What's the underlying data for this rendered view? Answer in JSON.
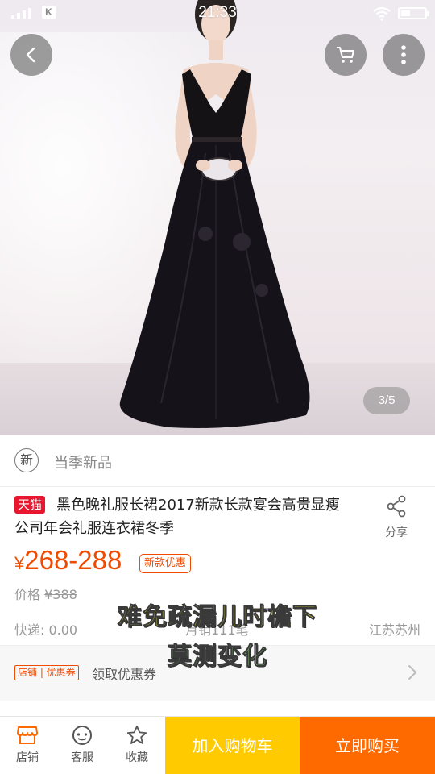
{
  "status_bar": {
    "time": "21:33",
    "app_badge": "K",
    "battery_level": 0.35
  },
  "gallery": {
    "counter": "3/5"
  },
  "season": {
    "icon_text": "新",
    "label": "当季新品"
  },
  "product": {
    "store_tag": "天猫",
    "title": "黑色晚礼服长裙2017新款长款宴会高贵显瘦公司年会礼服连衣裙冬季",
    "share_label": "分享",
    "price_symbol": "¥",
    "price_range": "268-288",
    "promo_tag": "新款优惠",
    "orig_price_label": "价格",
    "orig_price_value": "¥388",
    "express": "快递: 0.00",
    "monthly_sales": "月销111笔",
    "location": "江苏苏州"
  },
  "coupon": {
    "tag": "店铺 | 优惠券",
    "text": "领取优惠券"
  },
  "subtitles": {
    "line1": "难免疏漏儿时檐下",
    "line2": "莫测变化"
  },
  "bottom_bar": {
    "store": "店铺",
    "service": "客服",
    "favorite": "收藏",
    "add_to_cart": "加入购物车",
    "buy_now": "立即购买"
  },
  "colors": {
    "accent": "#f04b00",
    "tmall": "#e8162e",
    "cart_button": "#ffcb00",
    "buy_button": "#ff6a00"
  }
}
